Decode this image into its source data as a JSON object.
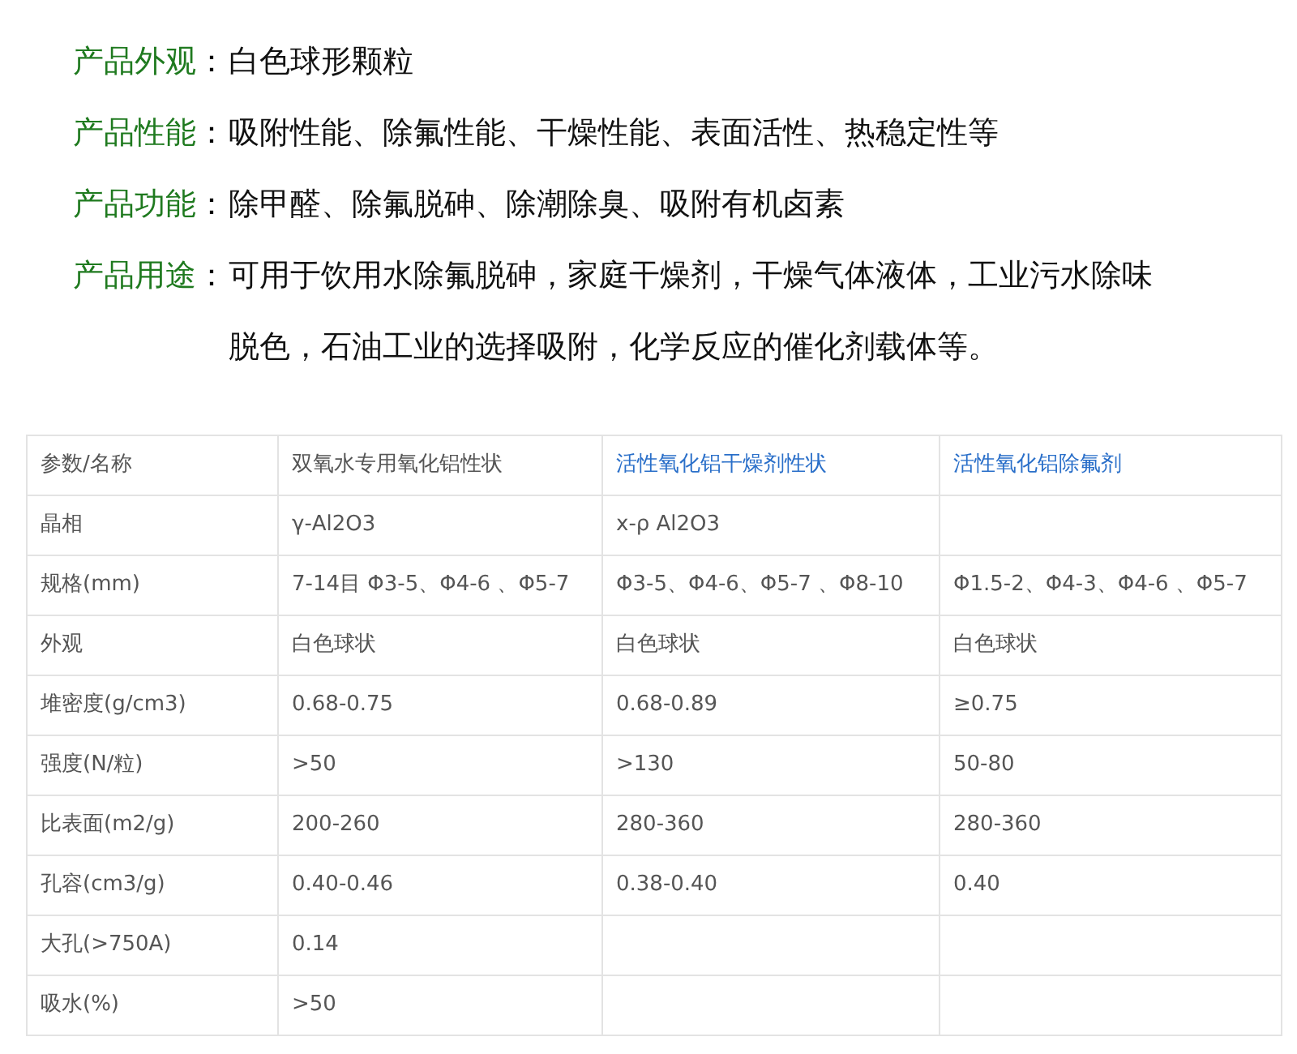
{
  "specs": [
    {
      "label": "产品外观",
      "colon": "：",
      "value": "白色球形颗粒"
    },
    {
      "label": "产品性能",
      "colon": "：",
      "value": "吸附性能、除氟性能、干燥性能、表面活性、热稳定性等"
    },
    {
      "label": "产品功能",
      "colon": "：",
      "value": "除甲醛、除氟脱砷、除潮除臭、吸附有机卤素"
    },
    {
      "label": "产品用途",
      "colon": "：",
      "value": "可用于饮用水除氟脱砷，家庭干燥剂，干燥气体液体，工业污水除味脱色，石油工业的选择吸附，化学反应的催化剂载体等。"
    }
  ],
  "table": {
    "columns": [
      {
        "label": "参数/名称",
        "link": false
      },
      {
        "label": "双氧水专用氧化铝性状",
        "link": false
      },
      {
        "label": "活性氧化铝干燥剂性状",
        "link": true
      },
      {
        "label": "活性氧化铝除氟剂",
        "link": true
      }
    ],
    "rows": [
      [
        "晶相",
        "γ-Al2O3",
        "x-ρ Al2O3",
        ""
      ],
      [
        "规格(mm)",
        "7-14目 Φ3-5、Φ4-6 、Φ5-7",
        "Φ3-5、Φ4-6、Φ5-7 、Φ8-10",
        "Φ1.5-2、Φ4-3、Φ4-6 、Φ5-7"
      ],
      [
        "外观",
        "白色球状",
        "白色球状",
        "白色球状"
      ],
      [
        "堆密度(g/cm3)",
        "0.68-0.75",
        "0.68-0.89",
        "≥0.75"
      ],
      [
        "强度(N/粒)",
        ">50",
        ">130",
        "50-80"
      ],
      [
        "比表面(m2/g)",
        "200-260",
        "280-360",
        "280-360"
      ],
      [
        "孔容(cm3/g)",
        "0.40-0.46",
        "0.38-0.40",
        "0.40"
      ],
      [
        "大孔(>750A)",
        "0.14",
        "",
        ""
      ],
      [
        "吸水(%)",
        ">50",
        "",
        ""
      ]
    ]
  }
}
